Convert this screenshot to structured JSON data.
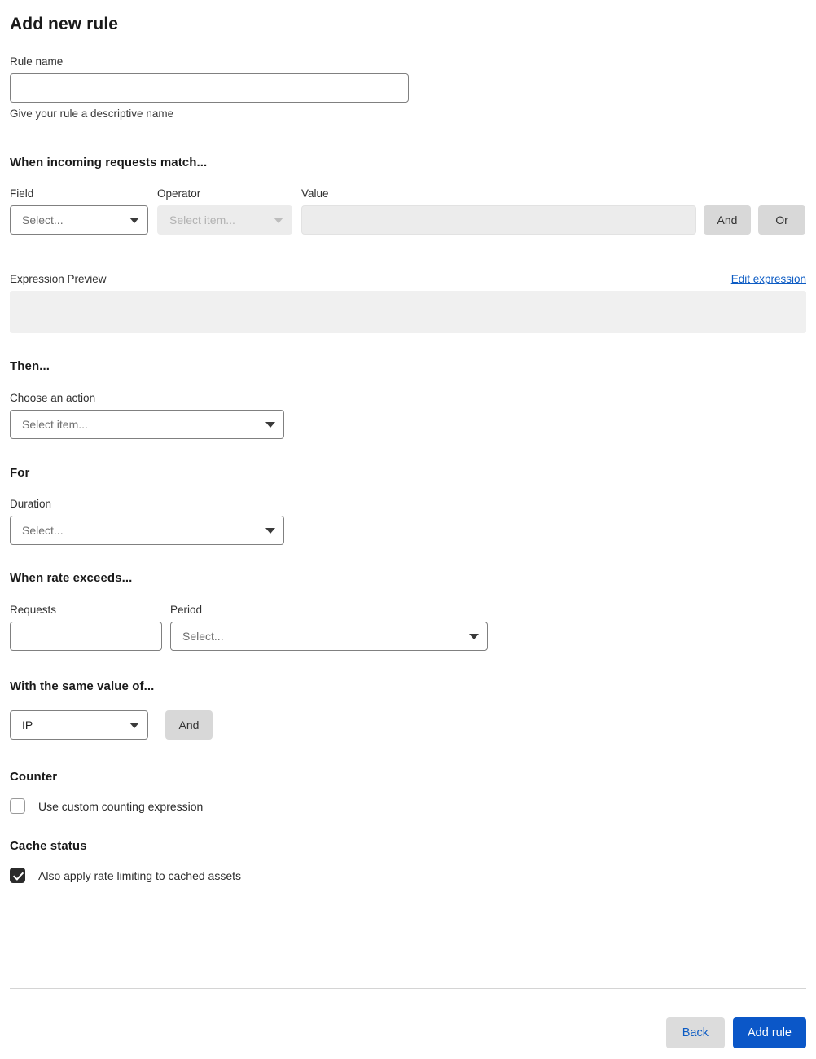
{
  "page": {
    "title": "Add new rule"
  },
  "rule_name": {
    "label": "Rule name",
    "value": "",
    "placeholder": "",
    "helper": "Give your rule a descriptive name"
  },
  "match": {
    "heading": "When incoming requests match...",
    "field": {
      "label": "Field",
      "value": "Select...",
      "disabled": false
    },
    "operator": {
      "label": "Operator",
      "value": "Select item...",
      "disabled": true
    },
    "value_input": {
      "label": "Value",
      "value": "",
      "placeholder": "",
      "disabled": true
    },
    "and_label": "And",
    "or_label": "Or"
  },
  "expression": {
    "label": "Expression Preview",
    "edit_link": "Edit expression",
    "content": ""
  },
  "then": {
    "heading": "Then...",
    "action": {
      "label": "Choose an action",
      "value": "Select item..."
    }
  },
  "duration": {
    "heading": "For",
    "field": {
      "label": "Duration",
      "value": "Select..."
    }
  },
  "rate": {
    "heading": "When rate exceeds...",
    "requests": {
      "label": "Requests",
      "value": "",
      "placeholder": ""
    },
    "period": {
      "label": "Period",
      "value": "Select..."
    }
  },
  "same_value": {
    "heading": "With the same value of...",
    "characteristic": {
      "value": "IP"
    },
    "and_label": "And"
  },
  "counter": {
    "heading": "Counter",
    "checkbox_label": "Use custom counting expression",
    "checked": false
  },
  "cache_status": {
    "heading": "Cache status",
    "checkbox_label": "Also apply rate limiting to cached assets",
    "checked": true
  },
  "footer": {
    "back_label": "Back",
    "submit_label": "Add rule"
  },
  "colors": {
    "primary_blue": "#0b57c8",
    "link_blue": "#0d5cc4",
    "disabled_grey": "#ececec",
    "button_grey": "#d8d8d8"
  }
}
